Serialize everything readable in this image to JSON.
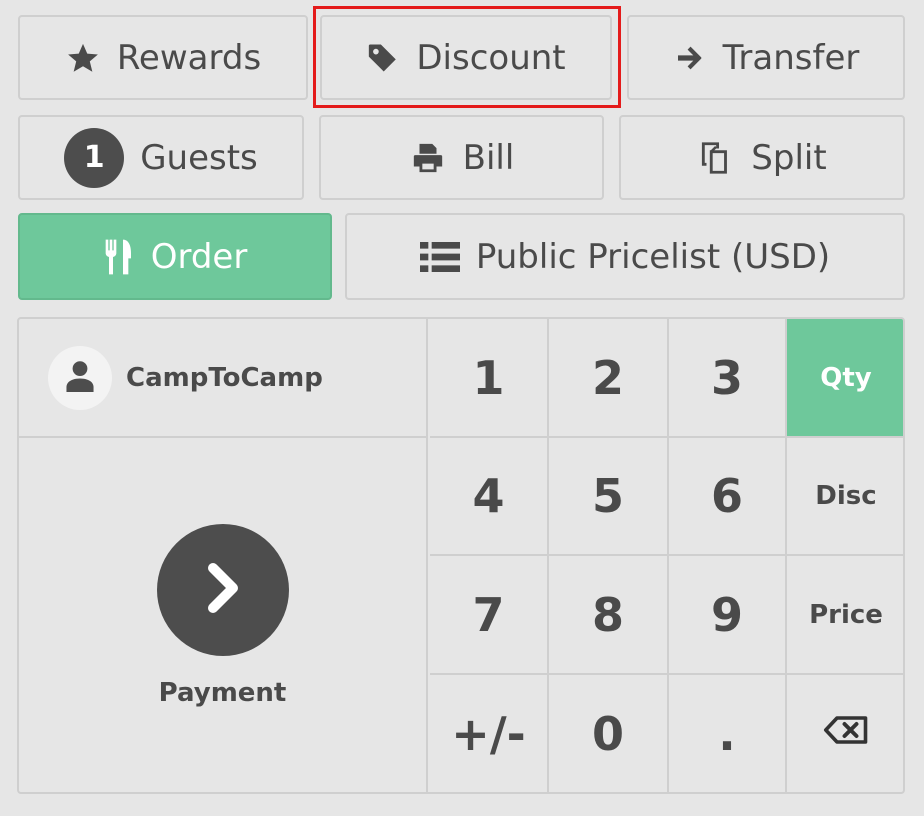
{
  "actions": {
    "rewards_label": "Rewards",
    "discount_label": "Discount",
    "transfer_label": "Transfer",
    "guests_count": "1",
    "guests_label": "Guests",
    "bill_label": "Bill",
    "split_label": "Split",
    "order_label": "Order",
    "pricelist_label": "Public Pricelist (USD)"
  },
  "customer": {
    "name": "CampToCamp"
  },
  "payment": {
    "label": "Payment"
  },
  "numpad": {
    "digits": [
      "1",
      "2",
      "3",
      "4",
      "5",
      "6",
      "7",
      "8",
      "9",
      "+/-",
      "0",
      "."
    ],
    "modes": [
      "Qty",
      "Disc",
      "Price"
    ],
    "active_mode": "Qty"
  },
  "colors": {
    "accent": "#6ec89b",
    "highlight": "#e41b1b",
    "background": "#e6e6e6",
    "text": "#4a4a4a"
  }
}
